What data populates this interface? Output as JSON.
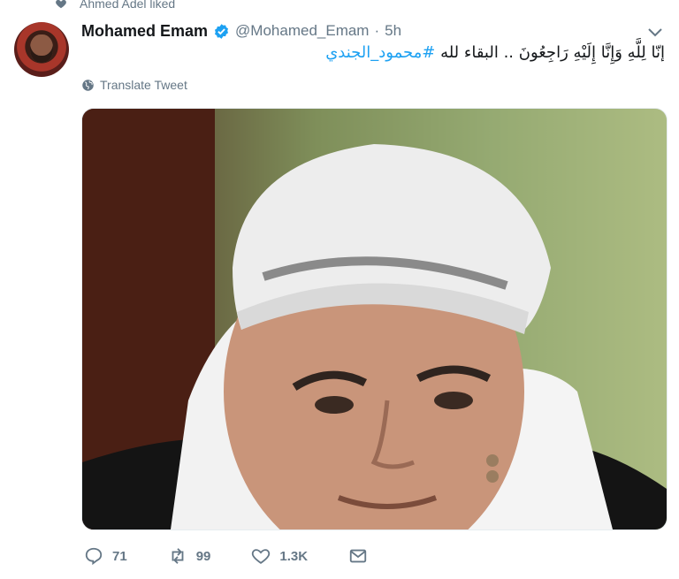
{
  "liked_by": "Ahmed Adel liked",
  "tweet": {
    "author_name": "Mohamed Emam",
    "handle": "@Mohamed_Emam",
    "separator": "·",
    "time": "5h",
    "text": "إنّا لِلَّهِ وَإِنَّا إِلَيْهِ رَاجِعُونَ .. البقاء لله",
    "hashtag": "#محمود_الجندي",
    "translate_label": "Translate Tweet"
  },
  "actions": {
    "replies": "71",
    "retweets": "99",
    "likes": "1.3K"
  },
  "colors": {
    "link": "#1da1f2",
    "secondary_text": "#657786",
    "verified": "#1da1f2"
  },
  "icons": [
    "heart-icon",
    "verified-badge-icon",
    "chevron-down-icon",
    "globe-icon",
    "reply-icon",
    "retweet-icon",
    "like-icon",
    "dm-icon"
  ]
}
